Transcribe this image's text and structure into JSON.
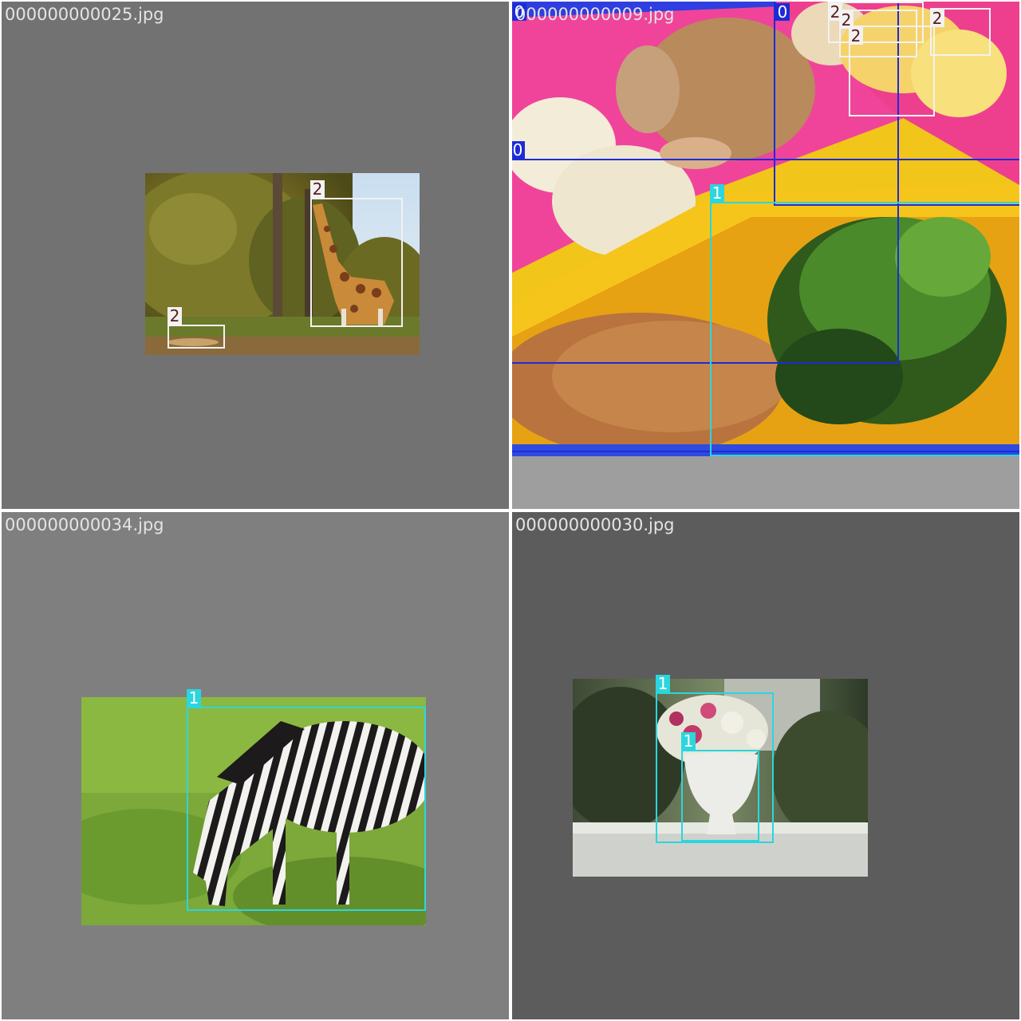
{
  "tiles": {
    "tl": {
      "filename": "000000000025.jpg",
      "labels": [
        "2",
        "2"
      ]
    },
    "tr": {
      "filename": "000000000009.jpg",
      "labels": [
        "0",
        "0",
        "0",
        "1",
        "2",
        "2",
        "2",
        "2"
      ]
    },
    "bl": {
      "filename": "000000000034.jpg",
      "labels": [
        "1"
      ]
    },
    "br": {
      "filename": "000000000030.jpg",
      "labels": [
        "1",
        "1"
      ]
    }
  },
  "class_colors": {
    "0": "#1d2bd6",
    "1": "#2bd6de",
    "2": "#f2f2f2"
  }
}
